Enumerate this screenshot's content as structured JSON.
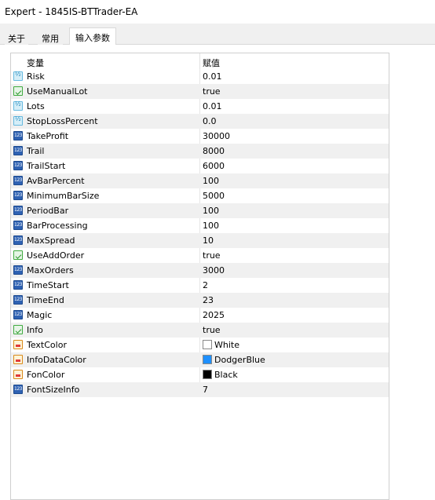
{
  "window": {
    "title": "Expert - 1845IS-BTTrader-EA"
  },
  "tabs": [
    {
      "label": "关于",
      "active": false
    },
    {
      "label": "常用",
      "active": false
    },
    {
      "label": "输入参数",
      "active": true
    }
  ],
  "table": {
    "headers": {
      "variable": "变量",
      "value": "赋值"
    },
    "rows": [
      {
        "icon": "double-icon",
        "name": "Risk",
        "value": "0.01"
      },
      {
        "icon": "bool-icon",
        "name": "UseManualLot",
        "value": "true"
      },
      {
        "icon": "double-icon",
        "name": "Lots",
        "value": "0.01"
      },
      {
        "icon": "double-icon",
        "name": "StopLossPercent",
        "value": "0.0"
      },
      {
        "icon": "int-icon",
        "name": "TakeProfit",
        "value": "30000"
      },
      {
        "icon": "int-icon",
        "name": "Trail",
        "value": "8000"
      },
      {
        "icon": "int-icon",
        "name": "TrailStart",
        "value": "6000"
      },
      {
        "icon": "int-icon",
        "name": "AvBarPercent",
        "value": "100"
      },
      {
        "icon": "int-icon",
        "name": "MinimumBarSize",
        "value": "5000"
      },
      {
        "icon": "int-icon",
        "name": "PeriodBar",
        "value": "100"
      },
      {
        "icon": "int-icon",
        "name": "BarProcessing",
        "value": "100"
      },
      {
        "icon": "int-icon",
        "name": "MaxSpread",
        "value": "10"
      },
      {
        "icon": "bool-icon",
        "name": "UseAddOrder",
        "value": "true"
      },
      {
        "icon": "int-icon",
        "name": "MaxOrders",
        "value": "3000"
      },
      {
        "icon": "int-icon",
        "name": "TimeStart",
        "value": "2"
      },
      {
        "icon": "int-icon",
        "name": "TimeEnd",
        "value": "23"
      },
      {
        "icon": "int-icon",
        "name": "Magic",
        "value": "2025"
      },
      {
        "icon": "bool-icon",
        "name": "Info",
        "value": "true"
      },
      {
        "icon": "color-icon",
        "name": "TextColor",
        "value": "White",
        "swatch": "#ffffff"
      },
      {
        "icon": "color-icon",
        "name": "InfoDataColor",
        "value": "DodgerBlue",
        "swatch": "#1e90ff"
      },
      {
        "icon": "color-icon",
        "name": "FonColor",
        "value": "Black",
        "swatch": "#000000"
      },
      {
        "icon": "int-icon",
        "name": "FontSizeInfo",
        "value": "7"
      }
    ]
  }
}
